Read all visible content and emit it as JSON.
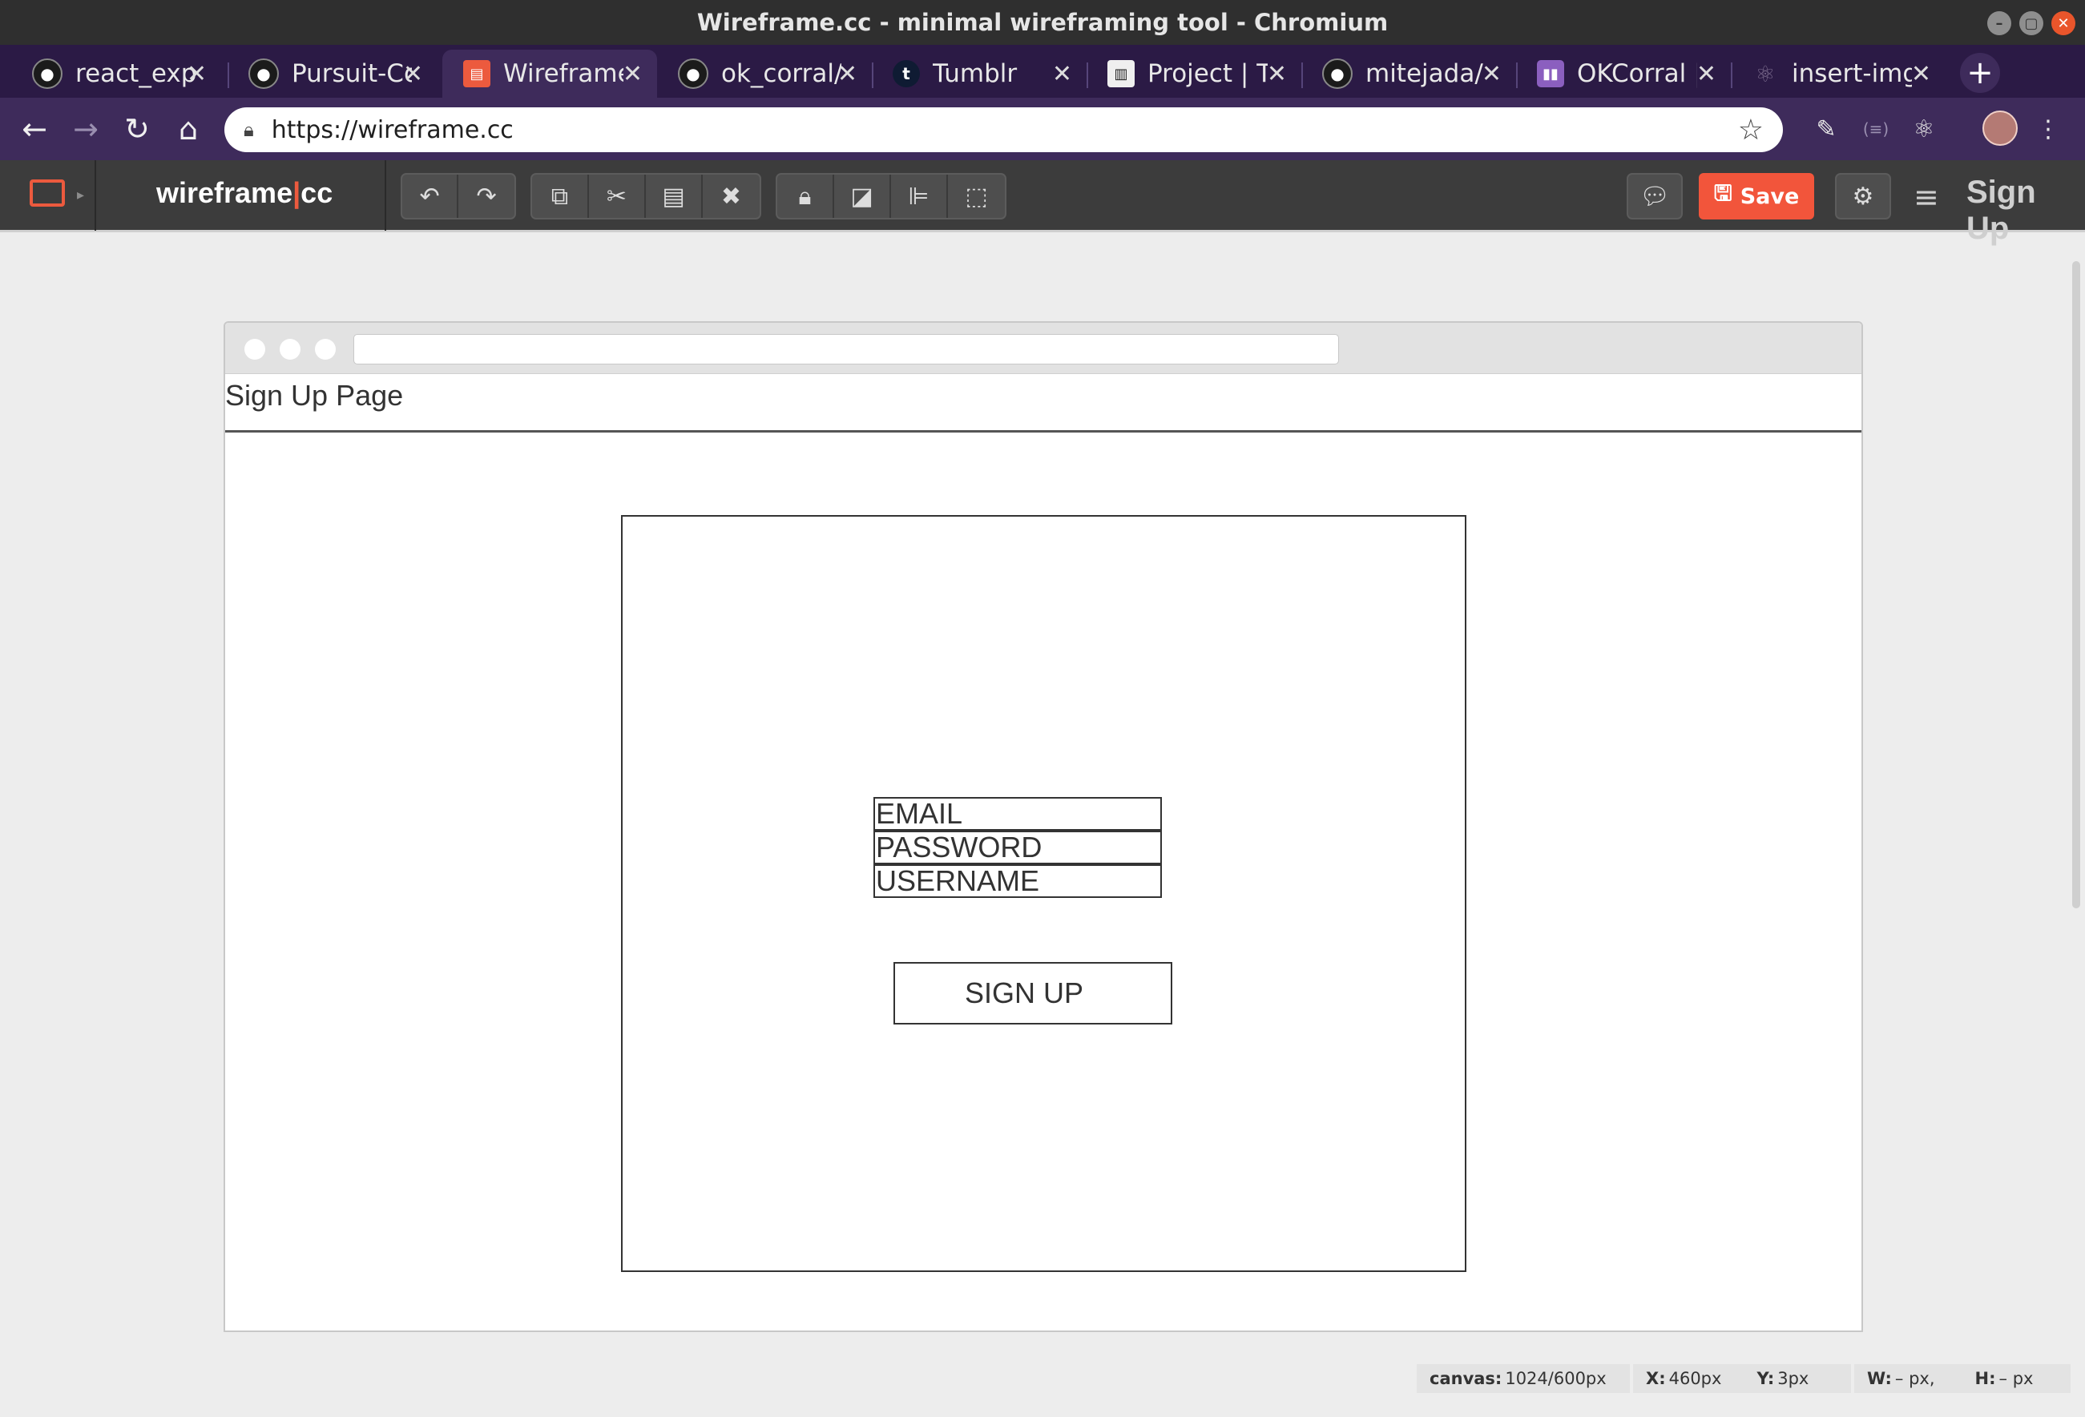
{
  "window": {
    "title": "Wireframe.cc - minimal wireframing tool - Chromium"
  },
  "tabs": [
    {
      "label": "react_expl",
      "icon": "github-icon"
    },
    {
      "label": "Pursuit-Co",
      "icon": "github-icon"
    },
    {
      "label": "Wireframe",
      "icon": "wireframe-icon",
      "active": true
    },
    {
      "label": "ok_corral/",
      "icon": "github-icon"
    },
    {
      "label": "Tumblr",
      "icon": "tumblr-icon",
      "glyph": "t"
    },
    {
      "label": "Project | T",
      "icon": "project-icon"
    },
    {
      "label": "mitejada/",
      "icon": "github-icon"
    },
    {
      "label": "OKCorral |",
      "icon": "trello-icon"
    },
    {
      "label": "insert-img",
      "icon": "react-icon"
    }
  ],
  "address": {
    "url": "https://wireframe.cc"
  },
  "toolbar": {
    "brand_left": "wireframe",
    "brand_sep": "|",
    "brand_right": "cc",
    "save_label": "Save",
    "signup_label": "Sign Up",
    "accent": "#ec5a3e",
    "save_color": "#f2553b"
  },
  "canvas": {
    "page_title": "Sign Up Page",
    "fields": [
      "EMAIL",
      "PASSWORD",
      "USERNAME"
    ],
    "button_label": "SIGN UP"
  },
  "status": {
    "canvas_label": "canvas:",
    "canvas_value": "1024/600px",
    "x_label": "X:",
    "x_value": "460px",
    "y_label": "Y:",
    "y_value": "3px",
    "w_label": "W:",
    "w_value": "– px,",
    "h_label": "H:",
    "h_value": "– px"
  }
}
